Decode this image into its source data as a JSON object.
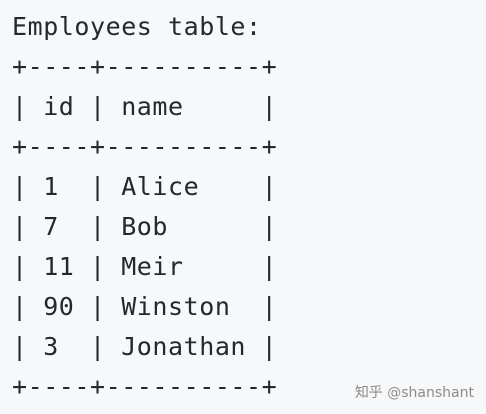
{
  "title": "Employees table:",
  "table_lines": [
    "+----+----------+",
    "| id | name     |",
    "+----+----------+",
    "| 1  | Alice    |",
    "| 7  | Bob      |",
    "| 11 | Meir     |",
    "| 90 | Winston  |",
    "| 3  | Jonathan |",
    "+----+----------+"
  ],
  "table": {
    "columns": [
      "id",
      "name"
    ],
    "rows": [
      [
        "1",
        "Alice"
      ],
      [
        "7",
        "Bob"
      ],
      [
        "11",
        "Meir"
      ],
      [
        "90",
        "Winston"
      ],
      [
        "3",
        "Jonathan"
      ]
    ]
  },
  "watermark": "知乎 @shanshant"
}
